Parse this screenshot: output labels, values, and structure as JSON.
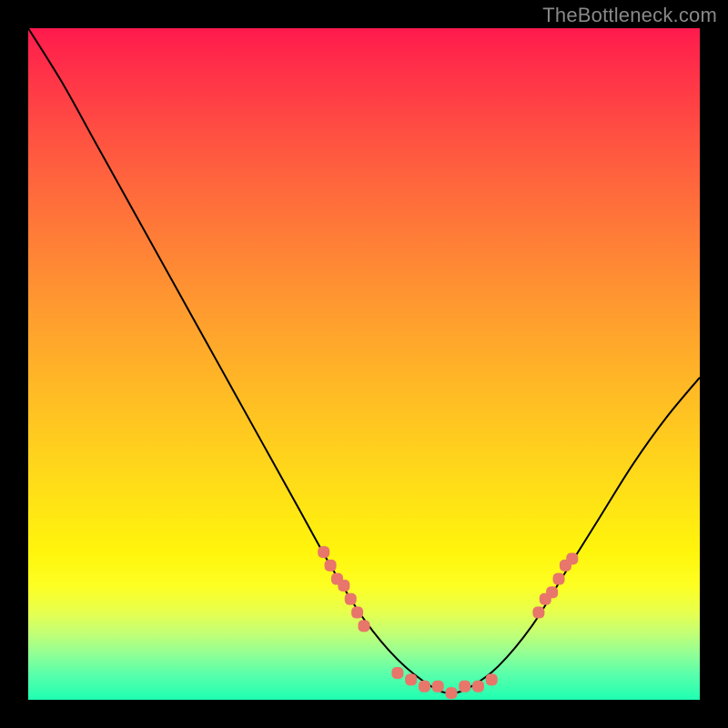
{
  "watermark": "TheBottleneck.com",
  "chart_data": {
    "type": "line",
    "title": "",
    "xlabel": "",
    "ylabel": "",
    "ylim": [
      0,
      100
    ],
    "xlim": [
      0,
      100
    ],
    "series": [
      {
        "name": "curve",
        "type": "spline",
        "stroke": "#000000",
        "stroke_width": 2,
        "x": [
          0,
          5,
          10,
          15,
          20,
          25,
          30,
          35,
          40,
          45,
          50,
          55,
          60,
          63,
          66,
          70,
          75,
          80,
          85,
          90,
          95,
          100
        ],
        "y": [
          100,
          92,
          83,
          74,
          65,
          56,
          47,
          38,
          29,
          20,
          12,
          6,
          2,
          1,
          2,
          5,
          11,
          19,
          27,
          35,
          42,
          48
        ]
      }
    ],
    "markers": [
      {
        "name": "left-scatter",
        "color": "#e8766a",
        "shape": "rounded-rect",
        "points": [
          {
            "x": 44,
            "y": 22
          },
          {
            "x": 45,
            "y": 20
          },
          {
            "x": 46,
            "y": 18
          },
          {
            "x": 47,
            "y": 17
          },
          {
            "x": 48,
            "y": 15
          },
          {
            "x": 49,
            "y": 13
          },
          {
            "x": 50,
            "y": 11
          }
        ]
      },
      {
        "name": "bottom-scatter",
        "color": "#e8766a",
        "shape": "rounded-rect",
        "points": [
          {
            "x": 55,
            "y": 4
          },
          {
            "x": 57,
            "y": 3
          },
          {
            "x": 59,
            "y": 2
          },
          {
            "x": 61,
            "y": 2
          },
          {
            "x": 63,
            "y": 1
          },
          {
            "x": 65,
            "y": 2
          },
          {
            "x": 67,
            "y": 2
          },
          {
            "x": 69,
            "y": 3
          }
        ]
      },
      {
        "name": "right-scatter",
        "color": "#e8766a",
        "shape": "rounded-rect",
        "points": [
          {
            "x": 76,
            "y": 13
          },
          {
            "x": 77,
            "y": 15
          },
          {
            "x": 78,
            "y": 16
          },
          {
            "x": 79,
            "y": 18
          },
          {
            "x": 80,
            "y": 20
          },
          {
            "x": 81,
            "y": 21
          }
        ]
      }
    ],
    "gradient_bg": {
      "direction": "vertical",
      "stops": [
        {
          "pos": 0.0,
          "color": "#ff1a4d"
        },
        {
          "pos": 0.5,
          "color": "#ffbd24"
        },
        {
          "pos": 0.82,
          "color": "#fdff22"
        },
        {
          "pos": 1.0,
          "color": "#1fffb2"
        }
      ]
    }
  }
}
